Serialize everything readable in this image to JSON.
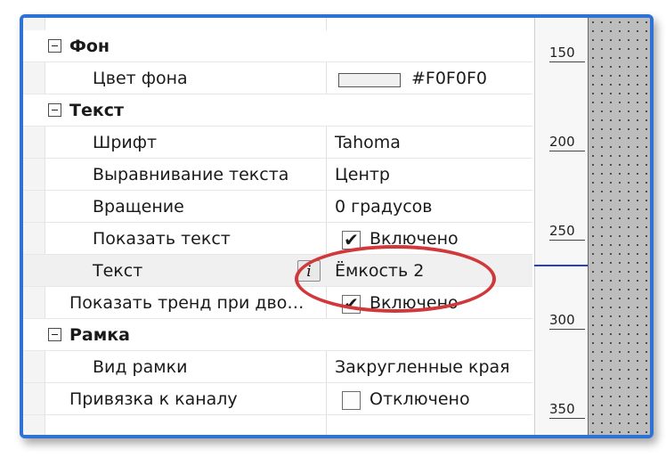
{
  "sections": {
    "background": {
      "title": "Фон",
      "color_label": "Цвет фона",
      "color_value": "#F0F0F0",
      "swatch_color": "#F0F0F0"
    },
    "text": {
      "title": "Текст",
      "font_label": "Шрифт",
      "font_value": "Tahoma",
      "align_label": "Выравнивание текста",
      "align_value": "Центр",
      "rotation_label": "Вращение",
      "rotation_value": "0 градусов",
      "show_text_label": "Показать текст",
      "show_text_value": "Включено",
      "text_label": "Текст",
      "text_value": "Ёмкость 2",
      "info_glyph": "i"
    },
    "trend": {
      "label": "Показать тренд при дво…",
      "value": "Включено"
    },
    "frame": {
      "title": "Рамка",
      "type_label": "Вид рамки",
      "type_value": "Закругленные края"
    },
    "channel": {
      "label": "Привязка к каналу",
      "value": "Отключено"
    }
  },
  "ruler": {
    "labels": [
      "150",
      "200",
      "250",
      "300",
      "350"
    ]
  },
  "colors": {
    "window_border": "#2f72d6",
    "highlight": "#d0383b",
    "marker": "#2a3fc2"
  }
}
